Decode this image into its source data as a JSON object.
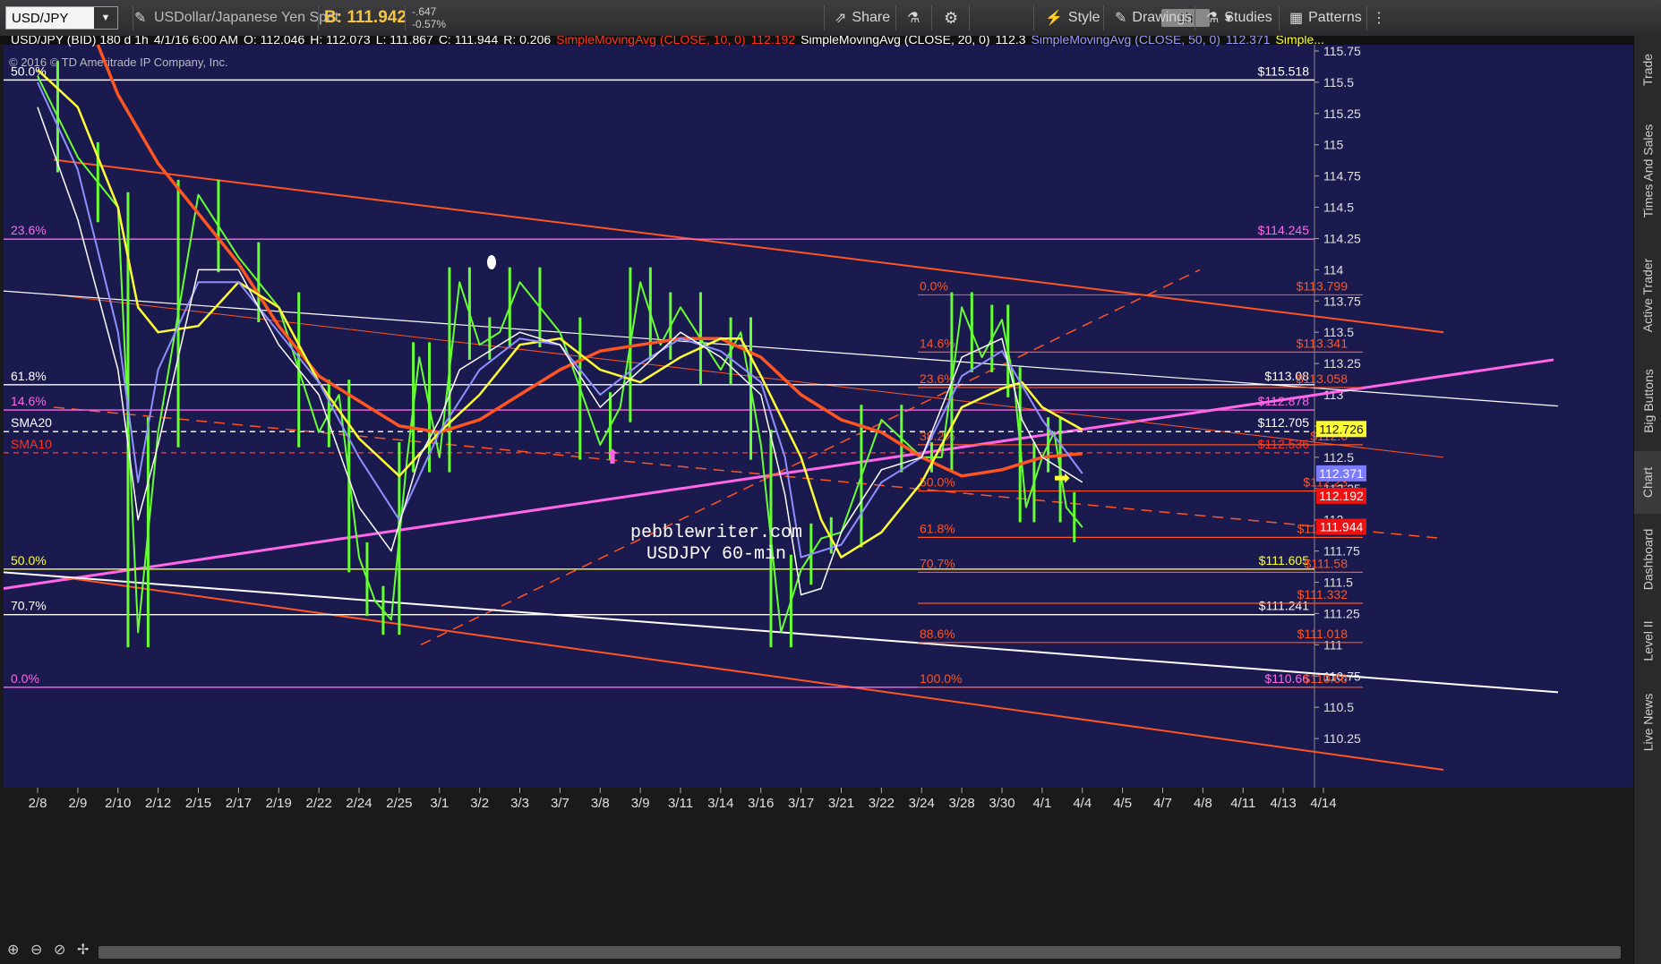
{
  "toolbar": {
    "symbol": "USD/JPY",
    "description": "USDollar/Japanese Yen Spot",
    "bid": "B: 111.942",
    "change": "-.647",
    "change_pct": "-0.57%",
    "share": "Share",
    "timeframe": "1h",
    "style": "Style",
    "drawings": "Drawings",
    "studies": "Studies",
    "patterns": "Patterns"
  },
  "sidebar": [
    "Trade",
    "Times And Sales",
    "Active Trader",
    "Big Buttons",
    "Chart",
    "Dashboard",
    "Level II",
    "Live News"
  ],
  "header": {
    "label": "USD/JPY (BID) 180 d 1h",
    "date": "4/1/16 6:00 AM",
    "o": "O: 112.046",
    "h": "H: 112.073",
    "l": "L: 111.867",
    "c": "C: 111.944",
    "r": "R: 0.206",
    "sma10": "SimpleMovingAvg (CLOSE, 10, 0)",
    "sma10_val": "112.192",
    "sma20": "SimpleMovingAvg (CLOSE, 20, 0)",
    "sma20_val": "112.3",
    "sma50": "SimpleMovingAvg (CLOSE, 50, 0)",
    "sma50_val": "112.371",
    "more": "Simple...",
    "copyright": "© 2016 © TD Ameritrade IP Company, Inc."
  },
  "colors": {
    "background": "#1b1a4f",
    "sma10": "#ff4422",
    "sma20": "#ffffff",
    "sma50": "#8f8fff",
    "sma100_yellow": "#ffff33",
    "sma200_red": "#ff5522",
    "magenta": "#ff66e8",
    "orange": "#ff5522",
    "candle": "#66ff33"
  },
  "watermark": [
    "pebblewriter.com",
    "USDJPY 60-min"
  ],
  "chart_data": {
    "type": "line",
    "ylim": [
      110.0,
      115.8
    ],
    "yticks": [
      115.75,
      115.5,
      115.25,
      115,
      114.75,
      114.5,
      114.25,
      114,
      113.75,
      113.5,
      113.25,
      113,
      112.75,
      112.5,
      112.25,
      112,
      111.75,
      111.5,
      111.25,
      111,
      110.75,
      110.5,
      110.25
    ],
    "ytick_labels": [
      "115.75",
      "115.5",
      "115.25",
      "115",
      "114.75",
      "114.5",
      "114.25",
      "114",
      "113.75",
      "113.5",
      "113.25",
      "113",
      "112.75",
      "112.5",
      "112.25",
      "112",
      "111.75",
      "111.5",
      "111.25",
      "111",
      "110.75",
      "110.5",
      "110.25"
    ],
    "xticks": [
      "2/8",
      "2/9",
      "2/10",
      "2/12",
      "2/15",
      "2/17",
      "2/19",
      "2/22",
      "2/24",
      "2/25",
      "3/1",
      "3/2",
      "3/3",
      "3/7",
      "3/8",
      "3/9",
      "3/11",
      "3/14",
      "3/16",
      "3/17",
      "3/21",
      "3/22",
      "3/24",
      "3/28",
      "3/30",
      "4/1",
      "4/4",
      "4/5",
      "4/7",
      "4/8",
      "4/11",
      "4/13",
      "4/14"
    ],
    "price": [
      [
        0,
        115.55
      ],
      [
        1,
        114.9
      ],
      [
        2,
        114.5
      ],
      [
        2.5,
        111.1
      ],
      [
        3,
        112.7
      ],
      [
        4,
        114.6
      ],
      [
        5,
        114.1
      ],
      [
        6,
        113.7
      ],
      [
        7,
        112.7
      ],
      [
        7.5,
        113
      ],
      [
        8,
        111.7
      ],
      [
        8.4,
        111.35
      ],
      [
        8.8,
        111.2
      ],
      [
        9.2,
        112.5
      ],
      [
        9.5,
        113.3
      ],
      [
        10,
        112.5
      ],
      [
        10.5,
        113.9
      ],
      [
        11,
        113.4
      ],
      [
        11.5,
        113.5
      ],
      [
        12,
        113.9
      ],
      [
        13,
        113.5
      ],
      [
        14,
        112.6
      ],
      [
        14.5,
        112.9
      ],
      [
        15,
        113.9
      ],
      [
        15.5,
        113.4
      ],
      [
        16,
        113.7
      ],
      [
        17,
        113.2
      ],
      [
        17.5,
        113.5
      ],
      [
        18,
        112.6
      ],
      [
        18.5,
        111.1
      ],
      [
        19,
        111.6
      ],
      [
        19.5,
        111.85
      ],
      [
        20,
        111.9
      ],
      [
        21,
        112.8
      ],
      [
        22,
        112.5
      ],
      [
        22.5,
        112.5
      ],
      [
        23,
        113.7
      ],
      [
        23.5,
        113.3
      ],
      [
        24,
        113.6
      ],
      [
        24.3,
        113.1
      ],
      [
        24.6,
        112.1
      ],
      [
        25,
        112.5
      ],
      [
        25.3,
        112.7
      ],
      [
        25.6,
        112.1
      ],
      [
        26,
        111.94
      ]
    ],
    "sma20": [
      [
        0,
        115.3
      ],
      [
        1,
        114.4
      ],
      [
        2,
        113.2
      ],
      [
        2.5,
        112.0
      ],
      [
        3,
        112.6
      ],
      [
        4,
        114.0
      ],
      [
        5,
        114.0
      ],
      [
        6,
        113.4
      ],
      [
        7,
        113.0
      ],
      [
        8,
        112.1
      ],
      [
        8.8,
        111.75
      ],
      [
        9.5,
        112.5
      ],
      [
        10,
        112.8
      ],
      [
        10.5,
        113.2
      ],
      [
        11,
        113.3
      ],
      [
        12,
        113.5
      ],
      [
        13,
        113.4
      ],
      [
        14,
        112.9
      ],
      [
        15,
        113.2
      ],
      [
        16,
        113.5
      ],
      [
        17,
        113.3
      ],
      [
        18,
        113.0
      ],
      [
        18.6,
        112.2
      ],
      [
        19,
        111.4
      ],
      [
        19.5,
        111.45
      ],
      [
        20,
        111.9
      ],
      [
        21,
        112.4
      ],
      [
        22,
        112.5
      ],
      [
        23,
        113.3
      ],
      [
        24,
        113.45
      ],
      [
        24.5,
        112.8
      ],
      [
        25,
        112.5
      ],
      [
        26,
        112.3
      ]
    ],
    "sma50": [
      [
        0,
        115.5
      ],
      [
        1,
        114.8
      ],
      [
        2,
        113.5
      ],
      [
        2.5,
        112.3
      ],
      [
        3,
        113.2
      ],
      [
        4,
        113.9
      ],
      [
        5,
        113.9
      ],
      [
        6,
        113.5
      ],
      [
        7,
        113.1
      ],
      [
        8,
        112.5
      ],
      [
        9,
        112.0
      ],
      [
        10,
        112.7
      ],
      [
        11,
        113.2
      ],
      [
        12,
        113.45
      ],
      [
        13,
        113.4
      ],
      [
        14,
        113.0
      ],
      [
        15,
        113.25
      ],
      [
        16,
        113.45
      ],
      [
        17,
        113.35
      ],
      [
        18,
        113.1
      ],
      [
        18.6,
        112.5
      ],
      [
        19,
        111.7
      ],
      [
        20,
        111.8
      ],
      [
        21,
        112.3
      ],
      [
        22,
        112.5
      ],
      [
        23,
        113.15
      ],
      [
        24,
        113.35
      ],
      [
        25,
        112.8
      ],
      [
        26,
        112.37
      ]
    ],
    "sma100": [
      [
        0,
        115.6
      ],
      [
        1,
        115.3
      ],
      [
        2,
        114.5
      ],
      [
        2.5,
        113.7
      ],
      [
        3,
        113.5
      ],
      [
        4,
        113.55
      ],
      [
        5,
        113.9
      ],
      [
        6,
        113.7
      ],
      [
        7,
        113.1
      ],
      [
        8,
        112.65
      ],
      [
        9,
        112.35
      ],
      [
        10,
        112.7
      ],
      [
        11,
        113.0
      ],
      [
        12,
        113.4
      ],
      [
        13,
        113.45
      ],
      [
        14,
        113.2
      ],
      [
        15,
        113.1
      ],
      [
        16,
        113.3
      ],
      [
        17,
        113.45
      ],
      [
        17.5,
        113.45
      ],
      [
        18,
        113.15
      ],
      [
        19,
        112.5
      ],
      [
        19.5,
        112.0
      ],
      [
        20,
        111.7
      ],
      [
        21,
        111.9
      ],
      [
        22,
        112.3
      ],
      [
        23,
        112.9
      ],
      [
        24,
        113.05
      ],
      [
        24.5,
        113.1
      ],
      [
        25,
        112.9
      ],
      [
        26,
        112.72
      ]
    ],
    "sma200": [
      [
        1.5,
        115.8
      ],
      [
        2,
        115.4
      ],
      [
        3,
        114.85
      ],
      [
        4,
        114.45
      ],
      [
        5,
        114.05
      ],
      [
        6,
        113.55
      ],
      [
        7,
        113.15
      ],
      [
        8,
        112.95
      ],
      [
        9,
        112.75
      ],
      [
        10,
        112.7
      ],
      [
        11,
        112.8
      ],
      [
        12,
        113.0
      ],
      [
        13,
        113.2
      ],
      [
        14,
        113.35
      ],
      [
        15,
        113.4
      ],
      [
        16,
        113.45
      ],
      [
        17,
        113.45
      ],
      [
        18,
        113.3
      ],
      [
        19,
        113.0
      ],
      [
        20,
        112.8
      ],
      [
        21,
        112.7
      ],
      [
        22,
        112.5
      ],
      [
        23,
        112.35
      ],
      [
        24,
        112.4
      ],
      [
        25,
        112.5
      ],
      [
        26,
        112.53
      ]
    ],
    "sma10_line": [
      [
        0,
        115.6
      ],
      [
        26,
        112.53
      ]
    ],
    "horizontal_levels": [
      {
        "value": 115.518,
        "label": "50.0%",
        "right": "$115.518",
        "color": "#ffffff"
      },
      {
        "value": 114.245,
        "label": "23.6%",
        "right": "$114.245",
        "color": "#ff66e8"
      },
      {
        "value": 113.08,
        "label": "61.8%",
        "right": "$113.08",
        "color": "#ffffff"
      },
      {
        "value": 112.878,
        "label": "14.6%",
        "right": "$112.878",
        "color": "#ff66e8"
      },
      {
        "value": 112.705,
        "label": "SMA20",
        "right": "$112.705",
        "color": "#ffffff",
        "dashed": true
      },
      {
        "value": 112.536,
        "label": "SMA10",
        "right": "$112.536",
        "color": "#ff3322",
        "dashed": true
      },
      {
        "value": 111.605,
        "label": "50.0%",
        "right": "$111.605",
        "color": "#ffff33"
      },
      {
        "value": 111.241,
        "label": "70.7%",
        "right": "$111.241",
        "color": "#ffffff"
      },
      {
        "value": 110.66,
        "label": "0.0%",
        "right": "$110.66",
        "color": "#ff66e8"
      }
    ],
    "fib_levels": [
      {
        "value": 113.799,
        "label": "0.0%",
        "right": "$113.799"
      },
      {
        "value": 113.341,
        "label": "14.6%",
        "right": "$113.341"
      },
      {
        "value": 113.058,
        "label": "23.6%",
        "right": "$113.058"
      },
      {
        "value": 112.6,
        "label": "38.2%",
        "right": "$112.6"
      },
      {
        "value": 112.23,
        "label": "50.0%",
        "right": "$112.23"
      },
      {
        "value": 111.859,
        "label": "61.8%",
        "right": "$111.859"
      },
      {
        "value": 111.58,
        "label": "70.7%",
        "right": "$111.58"
      },
      {
        "value": 111.332,
        "label": "",
        "right": "$111.332"
      },
      {
        "value": 111.018,
        "label": "88.6%",
        "right": "$111.018"
      },
      {
        "value": 110.66,
        "label": "100.0%",
        "right": "$110.66"
      }
    ],
    "price_tags": [
      {
        "value": 112.726,
        "label": "112.726",
        "bg": "#ffff33",
        "fg": "#111111"
      },
      {
        "value": 112.371,
        "label": "112.371",
        "bg": "#7b7bff",
        "fg": "#ffffff"
      },
      {
        "value": 112.192,
        "label": "112.192",
        "bg": "#ee1111",
        "fg": "#ffffff"
      },
      {
        "value": 111.944,
        "label": "111.944",
        "bg": "#ee1111",
        "fg": "#ffffff"
      }
    ]
  }
}
